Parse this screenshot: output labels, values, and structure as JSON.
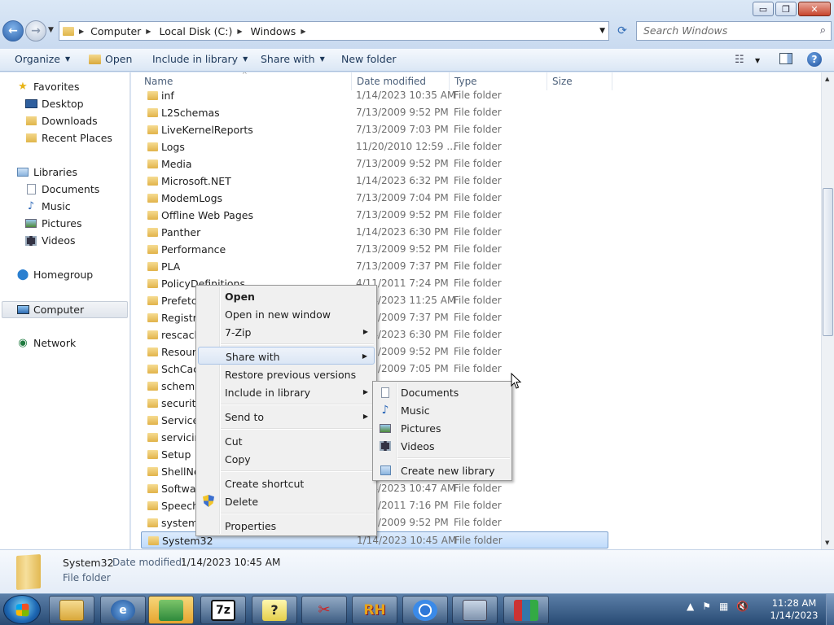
{
  "window": {
    "minimize": "▭",
    "maximize": "❐",
    "close": "✕"
  },
  "breadcrumbs": [
    "Computer",
    "Local Disk (C:)",
    "Windows"
  ],
  "search": {
    "placeholder": "Search Windows"
  },
  "toolbar": {
    "organize": "Organize",
    "open": "Open",
    "include_in_library": "Include in library",
    "share_with": "Share with",
    "new_folder": "New folder"
  },
  "navpane": {
    "favorites": "Favorites",
    "desktop": "Desktop",
    "downloads": "Downloads",
    "recent_places": "Recent Places",
    "libraries": "Libraries",
    "documents": "Documents",
    "music": "Music",
    "pictures": "Pictures",
    "videos": "Videos",
    "homegroup": "Homegroup",
    "computer": "Computer",
    "network": "Network"
  },
  "columns": {
    "name": "Name",
    "date_modified": "Date modified",
    "type": "Type",
    "size": "Size"
  },
  "rows": [
    {
      "name": "inf",
      "date": "1/14/2023 10:35 AM",
      "type": "File folder"
    },
    {
      "name": "L2Schemas",
      "date": "7/13/2009 9:52 PM",
      "type": "File folder"
    },
    {
      "name": "LiveKernelReports",
      "date": "7/13/2009 7:03 PM",
      "type": "File folder"
    },
    {
      "name": "Logs",
      "date": "11/20/2010 12:59 ...",
      "type": "File folder"
    },
    {
      "name": "Media",
      "date": "7/13/2009 9:52 PM",
      "type": "File folder"
    },
    {
      "name": "Microsoft.NET",
      "date": "1/14/2023 6:32 PM",
      "type": "File folder"
    },
    {
      "name": "ModemLogs",
      "date": "7/13/2009 7:04 PM",
      "type": "File folder"
    },
    {
      "name": "Offline Web Pages",
      "date": "7/13/2009 9:52 PM",
      "type": "File folder"
    },
    {
      "name": "Panther",
      "date": "1/14/2023 6:30 PM",
      "type": "File folder"
    },
    {
      "name": "Performance",
      "date": "7/13/2009 9:52 PM",
      "type": "File folder"
    },
    {
      "name": "PLA",
      "date": "7/13/2009 7:37 PM",
      "type": "File folder"
    },
    {
      "name": "PolicyDefinitions",
      "date": "4/11/2011 7:24 PM",
      "type": "File folder"
    },
    {
      "name": "Prefetch",
      "date": "1/14/2023 11:25 AM",
      "type": "File folder"
    },
    {
      "name": "Registration",
      "date": "7/13/2009 7:37 PM",
      "type": "File folder"
    },
    {
      "name": "rescache",
      "date": "1/14/2023 6:30 PM",
      "type": "File folder"
    },
    {
      "name": "Resources",
      "date": "7/13/2009 9:52 PM",
      "type": "File folder"
    },
    {
      "name": "SchCache",
      "date": "7/13/2009 7:05 PM",
      "type": "File folder"
    },
    {
      "name": "schemas",
      "date": "",
      "type": ""
    },
    {
      "name": "security",
      "date": "",
      "type": ""
    },
    {
      "name": "ServiceProfiles",
      "date": "",
      "type": ""
    },
    {
      "name": "servicing",
      "date": "",
      "type": ""
    },
    {
      "name": "Setup",
      "date": "",
      "type": ""
    },
    {
      "name": "ShellNew",
      "date": "",
      "type": ""
    },
    {
      "name": "SoftwareDistribution",
      "date": "1/14/2023 10:47 AM",
      "type": "File folder"
    },
    {
      "name": "Speech",
      "date": "4/11/2011 7:16 PM",
      "type": "File folder"
    },
    {
      "name": "system",
      "date": "7/13/2009 9:52 PM",
      "type": "File folder"
    },
    {
      "name": "System32",
      "date": "1/14/2023 10:45 AM",
      "type": "File folder"
    }
  ],
  "context_menu": {
    "open": "Open",
    "open_new_window": "Open in new window",
    "seven_zip": "7-Zip",
    "share_with": "Share with",
    "restore_previous": "Restore previous versions",
    "include_in_library": "Include in library",
    "send_to": "Send to",
    "cut": "Cut",
    "copy": "Copy",
    "create_shortcut": "Create shortcut",
    "delete": "Delete",
    "properties": "Properties"
  },
  "submenu": {
    "documents": "Documents",
    "music": "Music",
    "pictures": "Pictures",
    "videos": "Videos",
    "create_new_library": "Create new library"
  },
  "details": {
    "name": "System32",
    "date_label": "Date modified:",
    "date": "1/14/2023 10:45 AM",
    "type": "File folder"
  },
  "taskbar": {
    "seven_zip_label": "7z",
    "rh_label": "RH",
    "time": "11:28 AM",
    "date": "1/14/2023"
  }
}
